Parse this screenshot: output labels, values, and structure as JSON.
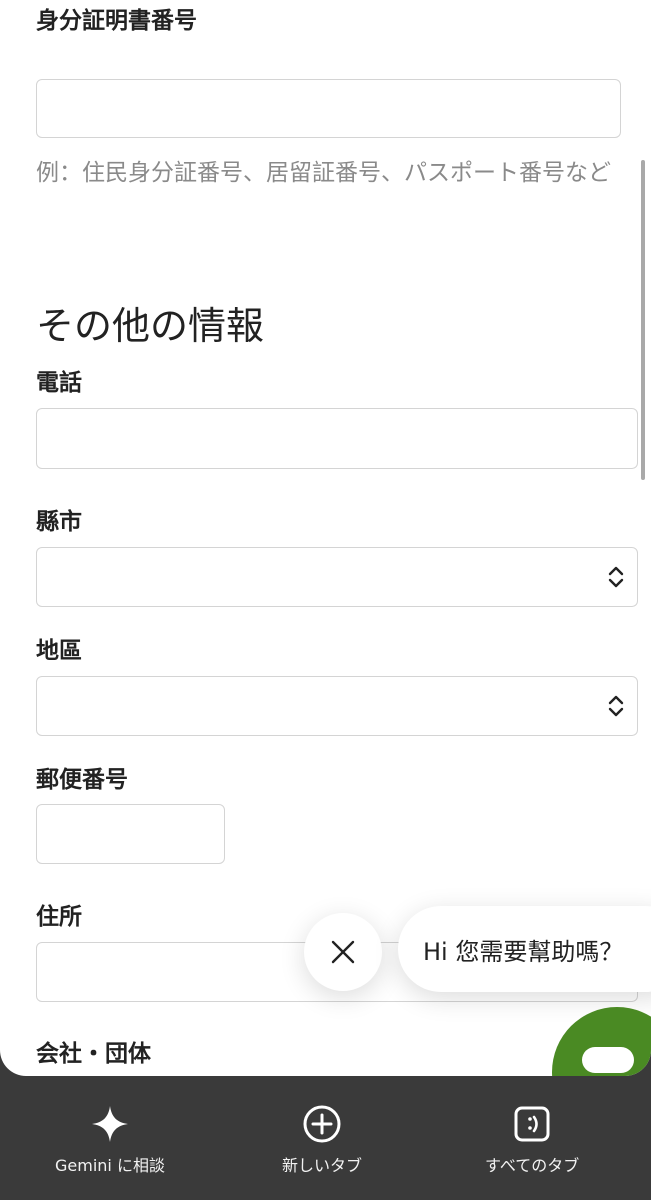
{
  "form": {
    "id_number": {
      "label": "身分証明書番号",
      "value": "",
      "hint": "例：住民身分証番号、居留証番号、パスポート番号など"
    },
    "other_section_title": "その他の情報",
    "phone": {
      "label": "電話",
      "value": ""
    },
    "county": {
      "label": "縣市",
      "selected": ""
    },
    "district": {
      "label": "地區",
      "selected": ""
    },
    "postal_code": {
      "label": "郵便番号",
      "value": ""
    },
    "address": {
      "label": "住所",
      "value": ""
    },
    "company": {
      "label": "会社・団体"
    }
  },
  "chat": {
    "greeting": "Hi 您需要幫助嗎？",
    "launcher_color": "#4a8a23"
  },
  "bottom_bar": {
    "items": [
      {
        "label": "Gemini に相談",
        "icon": "sparkle-icon"
      },
      {
        "label": "新しいタブ",
        "icon": "plus-circle-icon"
      },
      {
        "label": "すべてのタブ",
        "icon": "tabs-icon"
      }
    ]
  }
}
